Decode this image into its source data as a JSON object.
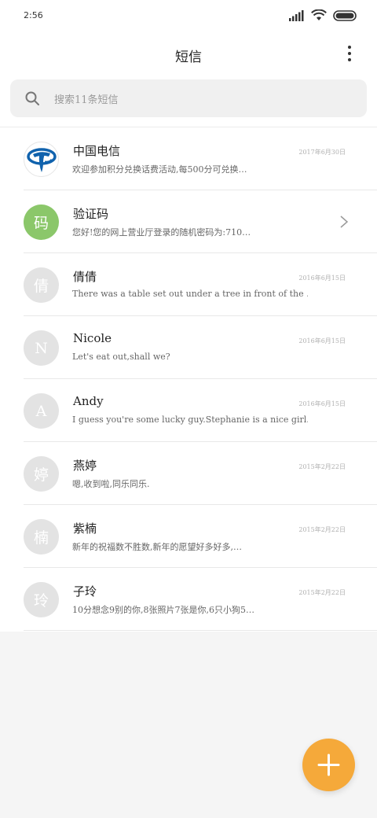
{
  "status_bar": {
    "time": "2:56"
  },
  "header": {
    "title": "短信",
    "more_icon": "more-vertical-icon"
  },
  "search": {
    "placeholder": "搜索11条短信",
    "icon": "search-icon"
  },
  "conversations": [
    {
      "name": "中国电信",
      "date": "2017年6月30日",
      "preview": "欢迎参加积分兑换话费活动,每500分可兑换…",
      "avatar_text": "",
      "avatar_type": "logo"
    },
    {
      "name": "验证码",
      "date": "",
      "preview": "您好!您的网上营业厅登录的随机密码为:710…",
      "avatar_text": "码",
      "avatar_type": "green"
    },
    {
      "name": "倩倩",
      "date": "2016年6月15日",
      "preview": "There was a table set out under a tree in front of the …",
      "avatar_text": "倩",
      "avatar_type": "gray"
    },
    {
      "name": "Nicole",
      "date": "2016年6月15日",
      "preview": "Let's eat out,shall we?",
      "avatar_text": "N",
      "avatar_type": "gray"
    },
    {
      "name": "Andy",
      "date": "2016年6月15日",
      "preview": "I guess you're some lucky guy.Stephanie is a nice girl.",
      "avatar_text": "A",
      "avatar_type": "gray"
    },
    {
      "name": "燕婷",
      "date": "2015年2月22日",
      "preview": "嗯,收到啦,同乐同乐.",
      "avatar_text": "婷",
      "avatar_type": "gray"
    },
    {
      "name": "紫楠",
      "date": "2015年2月22日",
      "preview": "新年的祝福数不胜数,新年的愿望好多好多,…",
      "avatar_text": "楠",
      "avatar_type": "gray"
    },
    {
      "name": "子玲",
      "date": "2015年2月22日",
      "preview": "10分想念9别的你,8张照片7张是你,6只小狗5…",
      "avatar_text": "玲",
      "avatar_type": "gray"
    }
  ],
  "fab": {
    "icon": "plus-icon",
    "color": "#f5a93a"
  },
  "colors": {
    "verify_avatar": "#8bc76a",
    "telecom_blue": "#1062ad"
  }
}
